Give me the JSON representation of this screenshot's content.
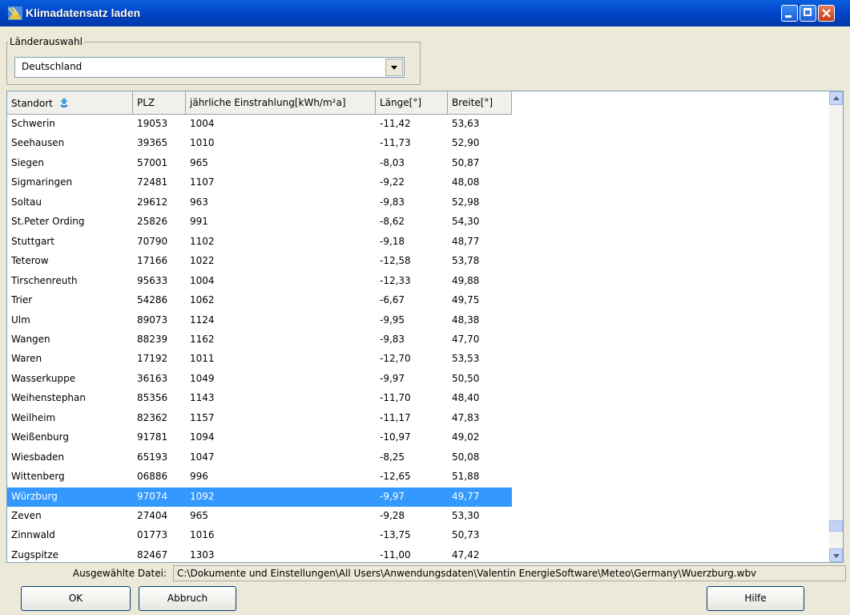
{
  "window": {
    "title": "Klimadatensatz laden"
  },
  "country": {
    "label": "Länderauswahl",
    "selected": "Deutschland"
  },
  "table": {
    "columns": [
      "Standort",
      "PLZ",
      "jährliche Einstrahlung[kWh/m²a]",
      "Länge[°]",
      "Breite[°]"
    ],
    "rows": [
      [
        "Schwerin",
        "19053",
        "1004",
        "-11,42",
        "53,63"
      ],
      [
        "Seehausen",
        "39365",
        "1010",
        "-11,73",
        "52,90"
      ],
      [
        "Siegen",
        "57001",
        "965",
        "-8,03",
        "50,87"
      ],
      [
        "Sigmaringen",
        "72481",
        "1107",
        "-9,22",
        "48,08"
      ],
      [
        "Soltau",
        "29612",
        "963",
        "-9,83",
        "52,98"
      ],
      [
        "St.Peter Ording",
        "25826",
        "991",
        "-8,62",
        "54,30"
      ],
      [
        "Stuttgart",
        "70790",
        "1102",
        "-9,18",
        "48,77"
      ],
      [
        "Teterow",
        "17166",
        "1022",
        "-12,58",
        "53,78"
      ],
      [
        "Tirschenreuth",
        "95633",
        "1004",
        "-12,33",
        "49,88"
      ],
      [
        "Trier",
        "54286",
        "1062",
        "-6,67",
        "49,75"
      ],
      [
        "Ulm",
        "89073",
        "1124",
        "-9,95",
        "48,38"
      ],
      [
        "Wangen",
        "88239",
        "1162",
        "-9,83",
        "47,70"
      ],
      [
        "Waren",
        "17192",
        "1011",
        "-12,70",
        "53,53"
      ],
      [
        "Wasserkuppe",
        "36163",
        "1049",
        "-9,97",
        "50,50"
      ],
      [
        "Weihenstephan",
        "85356",
        "1143",
        "-11,70",
        "48,40"
      ],
      [
        "Weilheim",
        "82362",
        "1157",
        "-11,17",
        "47,83"
      ],
      [
        "Weißenburg",
        "91781",
        "1094",
        "-10,97",
        "49,02"
      ],
      [
        "Wiesbaden",
        "65193",
        "1047",
        "-8,25",
        "50,08"
      ],
      [
        "Wittenberg",
        "06886",
        "996",
        "-12,65",
        "51,88"
      ],
      [
        "Würzburg",
        "97074",
        "1092",
        "-9,97",
        "49,77"
      ],
      [
        "Zeven",
        "27404",
        "965",
        "-9,28",
        "53,30"
      ],
      [
        "Zinnwald",
        "01773",
        "1016",
        "-13,75",
        "50,73"
      ],
      [
        "Zugspitze",
        "82467",
        "1303",
        "-11,00",
        "47,42"
      ]
    ],
    "selected_index": 19
  },
  "status": {
    "label": "Ausgewählte Datei:",
    "path": "C:\\Dokumente und Einstellungen\\All Users\\Anwendungsdaten\\Valentin EnergieSoftware\\Meteo\\Germany\\Wuerzburg.wbv"
  },
  "buttons": {
    "ok": "OK",
    "cancel": "Abbruch",
    "help": "Hilfe"
  },
  "colors": {
    "titlebar": "#0054E3",
    "selection": "#3399FF",
    "dialog_bg": "#ECE9D8"
  }
}
